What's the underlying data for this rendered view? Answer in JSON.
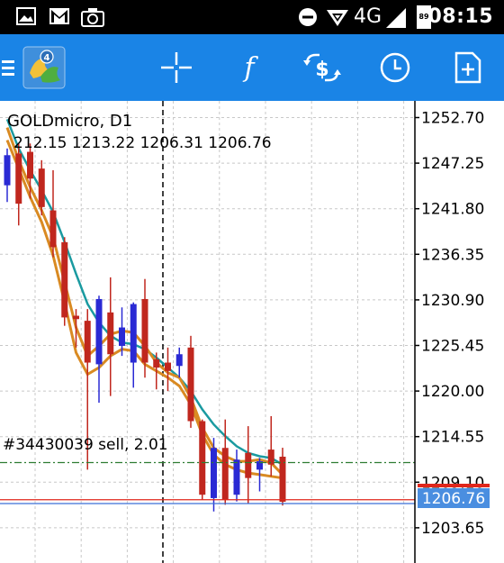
{
  "status_bar": {
    "network": "4G",
    "battery_level": "89",
    "time": "08:15"
  },
  "toolbar": {
    "icons": [
      "menu-icon",
      "metatrader-logo-icon",
      "crosshair-icon",
      "indicators-icon",
      "trade-icon",
      "clock-icon",
      "new-document-icon"
    ]
  },
  "chart": {
    "symbol_timeframe": "GOLDmicro, D1",
    "ohlc": "212.15 1213.22 1206.31 1206.76",
    "order_label": "#34430039 sell, 2.01",
    "current_price": "1206.76",
    "price_ticks": [
      "1252.70",
      "1247.25",
      "1241.80",
      "1236.35",
      "1230.90",
      "1225.45",
      "1220.00",
      "1214.55",
      "1209.10",
      "1203.65"
    ],
    "colors": {
      "bull_candle": "#2a2ad4",
      "bear_candle": "#c0271e",
      "ma_teal": "#1a9aa0",
      "ma_orange": "#d98a22",
      "price_tag_bg": "#4a8ee0",
      "order_line": "#2e7d32"
    }
  },
  "chart_data": {
    "type": "candlestick",
    "ylim": [
      1201.0,
      1255.0
    ],
    "ticks": [
      1252.7,
      1247.25,
      1241.8,
      1236.35,
      1230.9,
      1225.45,
      1220.0,
      1214.55,
      1209.1,
      1203.65
    ],
    "candles": [
      {
        "o": 1244.6,
        "h": 1249.0,
        "l": 1242.6,
        "c": 1248.2
      },
      {
        "o": 1248.4,
        "h": 1249.6,
        "l": 1239.8,
        "c": 1242.4
      },
      {
        "o": 1248.6,
        "h": 1249.6,
        "l": 1243.0,
        "c": 1245.4
      },
      {
        "o": 1246.6,
        "h": 1247.6,
        "l": 1241.0,
        "c": 1242.0
      },
      {
        "o": 1241.6,
        "h": 1246.4,
        "l": 1236.0,
        "c": 1237.2
      },
      {
        "o": 1237.8,
        "h": 1238.4,
        "l": 1227.8,
        "c": 1228.8
      },
      {
        "o": 1229.0,
        "h": 1229.8,
        "l": 1225.2,
        "c": 1228.6
      },
      {
        "o": 1228.4,
        "h": 1229.8,
        "l": 1210.6,
        "c": 1223.4
      },
      {
        "o": 1223.2,
        "h": 1231.4,
        "l": 1218.6,
        "c": 1231.0
      },
      {
        "o": 1229.4,
        "h": 1233.6,
        "l": 1219.4,
        "c": 1224.4
      },
      {
        "o": 1225.4,
        "h": 1230.0,
        "l": 1224.2,
        "c": 1227.6
      },
      {
        "o": 1223.4,
        "h": 1230.6,
        "l": 1220.4,
        "c": 1230.4
      },
      {
        "o": 1231.0,
        "h": 1233.4,
        "l": 1221.6,
        "c": 1223.4
      },
      {
        "o": 1223.8,
        "h": 1224.6,
        "l": 1220.2,
        "c": 1222.8
      },
      {
        "o": 1223.4,
        "h": 1225.2,
        "l": 1220.0,
        "c": 1222.4
      },
      {
        "o": 1223.0,
        "h": 1225.2,
        "l": 1221.6,
        "c": 1224.4
      },
      {
        "o": 1225.2,
        "h": 1226.6,
        "l": 1215.6,
        "c": 1216.4
      },
      {
        "o": 1216.4,
        "h": 1216.6,
        "l": 1207.0,
        "c": 1207.6
      },
      {
        "o": 1207.2,
        "h": 1214.4,
        "l": 1205.6,
        "c": 1213.2
      },
      {
        "o": 1213.2,
        "h": 1216.6,
        "l": 1206.4,
        "c": 1207.0
      },
      {
        "o": 1207.6,
        "h": 1213.0,
        "l": 1206.8,
        "c": 1211.8
      },
      {
        "o": 1212.6,
        "h": 1215.8,
        "l": 1206.6,
        "c": 1209.6
      },
      {
        "o": 1210.6,
        "h": 1212.0,
        "l": 1208.0,
        "c": 1211.6
      },
      {
        "o": 1213.0,
        "h": 1217.0,
        "l": 1209.8,
        "c": 1211.2
      },
      {
        "o": 1212.15,
        "h": 1213.22,
        "l": 1206.31,
        "c": 1206.76
      }
    ],
    "ma_teal": [
      1252.5,
      1249.0,
      1246.4,
      1244.0,
      1241.4,
      1237.8,
      1234.0,
      1230.4,
      1228.2,
      1226.6,
      1225.8,
      1225.6,
      1225.0,
      1224.0,
      1222.8,
      1221.6,
      1220.0,
      1217.8,
      1216.0,
      1214.6,
      1213.4,
      1212.6,
      1212.2,
      1212.0,
      1211.2
    ],
    "ma_orange_a": [
      1251.5,
      1247.6,
      1244.4,
      1241.6,
      1238.4,
      1233.0,
      1227.6,
      1224.2,
      1225.4,
      1226.8,
      1227.2,
      1227.0,
      1225.4,
      1223.4,
      1222.2,
      1221.6,
      1219.2,
      1215.6,
      1213.2,
      1212.2,
      1211.6,
      1211.6,
      1211.8,
      1211.4,
      1210.0
    ],
    "ma_orange_b": [
      1250.0,
      1246.6,
      1243.2,
      1240.2,
      1236.2,
      1230.6,
      1224.6,
      1222.0,
      1222.8,
      1224.2,
      1225.0,
      1224.8,
      1223.2,
      1222.4,
      1221.6,
      1220.6,
      1218.4,
      1214.8,
      1212.4,
      1211.2,
      1210.6,
      1210.2,
      1210.0,
      1209.8,
      1209.6
    ],
    "order_price": 1211.45,
    "bid_price": 1206.76,
    "ask_price": 1206.9,
    "red_marker_price": 1208.5
  }
}
